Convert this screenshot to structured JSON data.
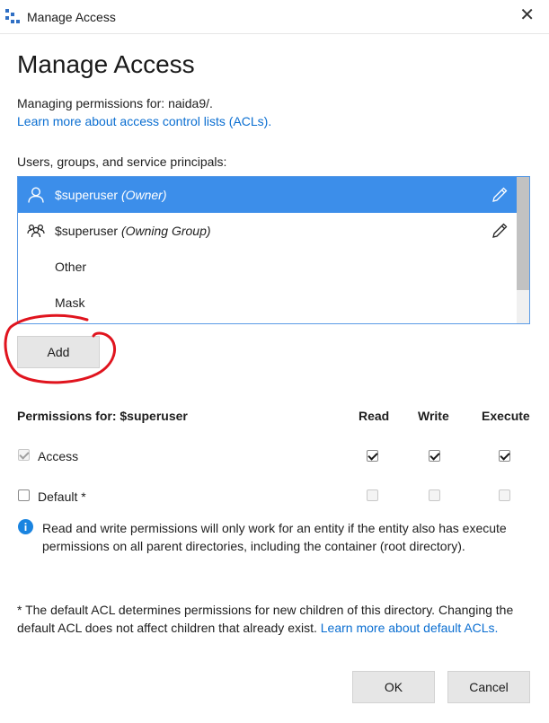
{
  "window": {
    "title": "Manage Access",
    "close_glyph": "✕",
    "app_icon": "storage-explorer-icon"
  },
  "dialog": {
    "heading": "Manage Access",
    "managing_text": "Managing permissions for: naida9/.",
    "learn_acl_link": "Learn more about access control lists (ACLs).",
    "principals_label": "Users, groups, and service principals:"
  },
  "principals": [
    {
      "name": "$superuser",
      "role": "(Owner)",
      "icon": "user-icon",
      "editable": true,
      "selected": true
    },
    {
      "name": "$superuser",
      "role": "(Owning Group)",
      "icon": "group-icon",
      "editable": true,
      "selected": false
    },
    {
      "name": "Other",
      "role": "",
      "icon": "",
      "editable": false,
      "selected": false
    },
    {
      "name": "Mask",
      "role": "",
      "icon": "",
      "editable": false,
      "selected": false
    }
  ],
  "add_button": "Add",
  "permissions": {
    "header": "Permissions for: $superuser",
    "columns": [
      "Read",
      "Write",
      "Execute"
    ],
    "rows": [
      {
        "label": "Access",
        "row_checked": true,
        "row_disabled": true,
        "values": [
          true,
          true,
          true
        ],
        "values_disabled": false
      },
      {
        "label": "Default *",
        "row_checked": false,
        "row_disabled": false,
        "values": [
          false,
          false,
          false
        ],
        "values_disabled": true
      }
    ]
  },
  "info_note": "Read and write permissions will only work for an entity if the entity also has execute permissions on all parent directories, including the container (root directory).",
  "footnote": {
    "text": "* The default ACL determines permissions for new children of this directory. Changing the default ACL does not affect children that already exist. ",
    "link": "Learn more about default ACLs."
  },
  "buttons": {
    "ok": "OK",
    "cancel": "Cancel"
  },
  "colors": {
    "selection": "#3c8eea",
    "link": "#0a6ed1",
    "annotation": "#e0141e"
  }
}
